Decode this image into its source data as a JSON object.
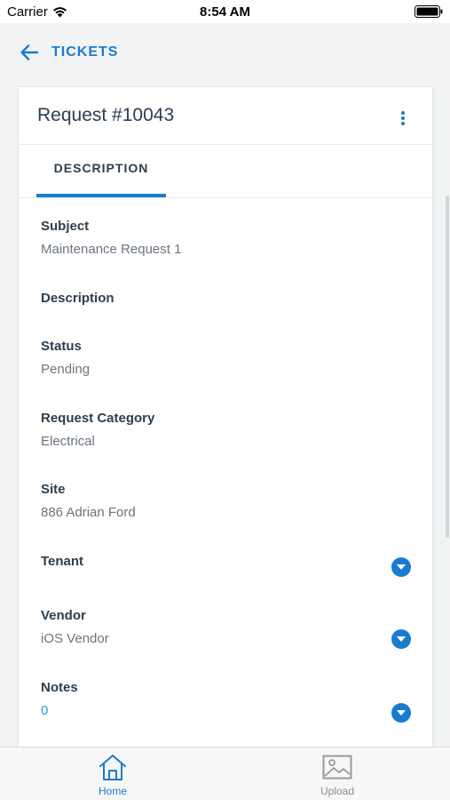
{
  "status_bar": {
    "carrier": "Carrier",
    "time": "8:54 AM"
  },
  "nav": {
    "back_label": "TICKETS"
  },
  "card": {
    "title": "Request #10043",
    "tabs": [
      {
        "label": "DESCRIPTION",
        "selected": true
      }
    ]
  },
  "fields": {
    "subject": {
      "label": "Subject",
      "value": "Maintenance Request 1"
    },
    "description": {
      "label": "Description",
      "value": ""
    },
    "status": {
      "label": "Status",
      "value": "Pending"
    },
    "request_category": {
      "label": "Request Category",
      "value": "Electrical"
    },
    "site": {
      "label": "Site",
      "value": "886 Adrian Ford"
    },
    "tenant": {
      "label": "Tenant",
      "value": ""
    },
    "vendor": {
      "label": "Vendor",
      "value": "iOS Vendor"
    },
    "notes": {
      "label": "Notes",
      "value": "0"
    }
  },
  "tab_bar": {
    "items": [
      {
        "label": "Home",
        "icon": "home-icon",
        "active": true
      },
      {
        "label": "Upload",
        "icon": "image-icon",
        "active": false
      }
    ]
  },
  "colors": {
    "accent": "#1a7bcf",
    "link": "#1aa3e8",
    "text": "#2c3e50",
    "muted": "#6b7580"
  }
}
